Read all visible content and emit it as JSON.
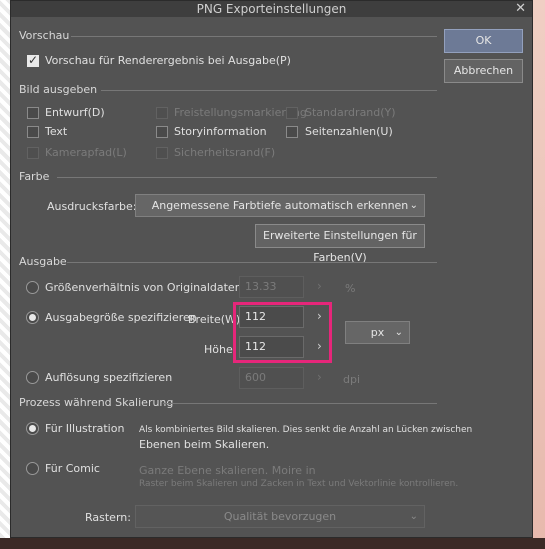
{
  "window": {
    "title": "PNG Exporteinstellungen",
    "close_glyph": "✕"
  },
  "buttons": {
    "ok": "OK",
    "cancel": "Abbrechen"
  },
  "preview": {
    "heading": "Vorschau",
    "checkbox_label": "Vorschau für Renderergebnis bei Ausgabe(P)",
    "checked": true
  },
  "output_image": {
    "heading": "Bild ausgeben",
    "items": [
      {
        "label": "Entwurf(D)",
        "enabled": true,
        "checked": false
      },
      {
        "label": "Freistellungsmarkierung",
        "enabled": false,
        "checked": false
      },
      {
        "label": "Standardrand(Y)",
        "enabled": false,
        "checked": false
      },
      {
        "label": "Text",
        "enabled": true,
        "checked": false
      },
      {
        "label": "Storyinformation",
        "enabled": true,
        "checked": false
      },
      {
        "label": "Seitenzahlen(U)",
        "enabled": true,
        "checked": false
      },
      {
        "label": "Kamerapfad(L)",
        "enabled": false,
        "checked": false
      },
      {
        "label": "Sicherheitsrand(F)",
        "enabled": false,
        "checked": false
      }
    ]
  },
  "color": {
    "heading": "Farbe",
    "label": "Ausdrucksfarbe:",
    "value": "Angemessene Farbtiefe automatisch erkennen",
    "advanced_button": "Erweiterte Einstellungen für Farben(V)"
  },
  "output": {
    "heading": "Ausgabe",
    "ratio_label": "Größenverhältnis von Originaldaten(Z)",
    "ratio_value": "13.33",
    "ratio_unit": "%",
    "size_label": "Ausgabegröße spezifizieren",
    "width_label": "Breite(W)",
    "width_value": "112",
    "height_label": "Höhe",
    "height_value": "112",
    "unit_value": "px",
    "resolution_label": "Auflösung spezifizieren",
    "resolution_value": "600",
    "resolution_unit": "dpi",
    "selected": "size"
  },
  "scaling": {
    "heading": "Prozess während Skalierung",
    "illustration_label": "Für Illustration",
    "illustration_desc_line1": "Als kombiniertes Bild skalieren. Dies senkt die Anzahl an Lücken zwischen",
    "illustration_desc_line2": "Ebenen beim Skalieren.",
    "comic_label": "Für Comic",
    "comic_desc_line1": "Ganze Ebene skalieren. Moire in",
    "comic_desc_line2": "Raster beim Skalieren und Zacken in Text und Vektorlinie kontrollieren.",
    "raster_label": "Rastern:",
    "raster_value": "Qualität bevorzugen",
    "selected": "illustration"
  },
  "glyphs": {
    "arrow_right": "›",
    "caret_down": "⌄"
  },
  "colors": {
    "dialog_bg": "#535353",
    "highlight": "#e6267a",
    "ok_button": "#6d7a96"
  }
}
